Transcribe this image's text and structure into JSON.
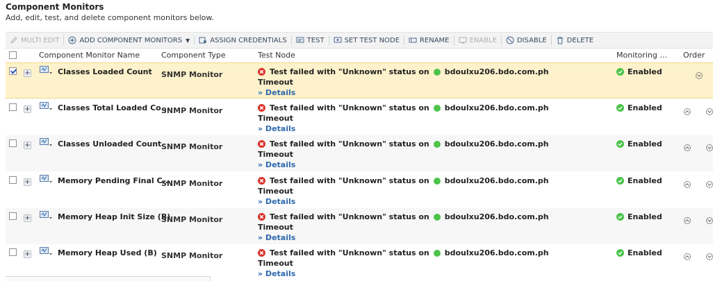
{
  "header": {
    "title": "Component Monitors",
    "subtitle": "Add, edit, test, and delete component monitors below."
  },
  "toolbar": {
    "multi_edit": "MULTI EDIT",
    "add_component_monitors": "ADD COMPONENT MONITORS",
    "assign_credentials": "ASSIGN CREDENTIALS",
    "test": "TEST",
    "set_test_node": "SET TEST NODE",
    "rename": "RENAME",
    "enable": "ENABLE",
    "disable": "DISABLE",
    "delete": "DELETE"
  },
  "columns": {
    "name": "Component Monitor Name",
    "type": "Component Type",
    "test_node": "Test Node",
    "monitoring": "Monitoring ...",
    "order": "Order"
  },
  "colors": {
    "selected_row": "#fdf2cb",
    "link": "#2e69ad",
    "ok_green": "#4cc44a",
    "error_red": "#d9342b"
  },
  "rows": [
    {
      "name": "Classes Loaded Count",
      "type": "SNMP Monitor",
      "test_prefix": "Test failed with \"Unknown\" status on",
      "node": "bdoulxu206.bdo.com.ph",
      "reason": "Timeout",
      "details": "» Details",
      "status": "Enabled",
      "checked": true
    },
    {
      "name": "Classes Total Loaded Co...",
      "type": "SNMP Monitor",
      "test_prefix": "Test failed with \"Unknown\" status on",
      "node": "bdoulxu206.bdo.com.ph",
      "reason": "Timeout",
      "details": "» Details",
      "status": "Enabled",
      "checked": false
    },
    {
      "name": "Classes Unloaded Count",
      "type": "SNMP Monitor",
      "test_prefix": "Test failed with \"Unknown\" status on",
      "node": "bdoulxu206.bdo.com.ph",
      "reason": "Timeout",
      "details": "» Details",
      "status": "Enabled",
      "checked": false
    },
    {
      "name": "Memory Pending Final C...",
      "type": "SNMP Monitor",
      "test_prefix": "Test failed with \"Unknown\" status on",
      "node": "bdoulxu206.bdo.com.ph",
      "reason": "Timeout",
      "details": "» Details",
      "status": "Enabled",
      "checked": false
    },
    {
      "name": "Memory Heap Init Size (B)",
      "type": "SNMP Monitor",
      "test_prefix": "Test failed with \"Unknown\" status on",
      "node": "bdoulxu206.bdo.com.ph",
      "reason": "Timeout",
      "details": "» Details",
      "status": "Enabled",
      "checked": false
    },
    {
      "name": "Memory Heap Used (B)",
      "type": "SNMP Monitor",
      "test_prefix": "Test failed with \"Unknown\" status on",
      "node": "bdoulxu206.bdo.com.ph",
      "reason": "Timeout",
      "details": "» Details",
      "status": "Enabled",
      "checked": false
    }
  ]
}
